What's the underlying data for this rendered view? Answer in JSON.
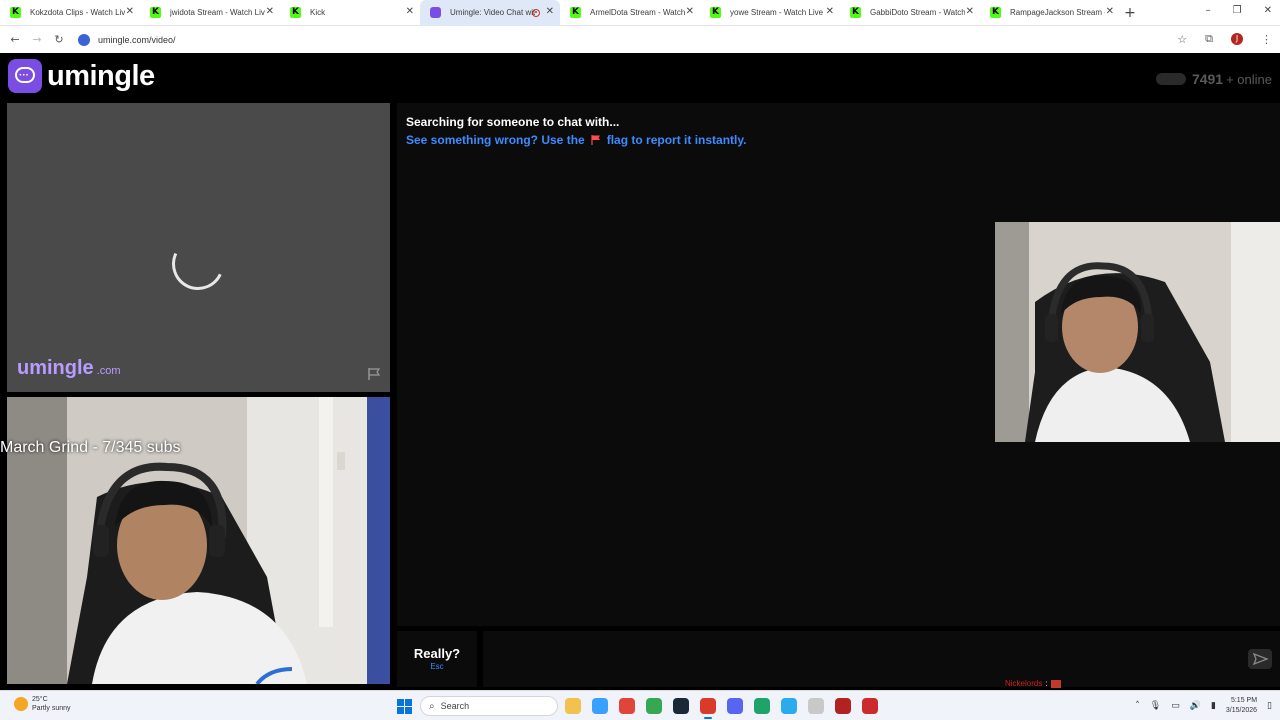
{
  "browser": {
    "tabs": [
      {
        "label": "Kokzdota Clips - Watch Live",
        "favicon": "kick"
      },
      {
        "label": "jwidota Stream - Watch Live",
        "favicon": "kick"
      },
      {
        "label": "Kick",
        "favicon": "kick"
      },
      {
        "label": "Umingle: Video Chat wit",
        "favicon": "umingle",
        "active": true,
        "recording": true
      },
      {
        "label": "ArmelDota Stream - Watch L",
        "favicon": "kick"
      },
      {
        "label": "yowe Stream - Watch Live o",
        "favicon": "kick"
      },
      {
        "label": "GabbiDoto Stream - Watch L",
        "favicon": "kick"
      },
      {
        "label": "RampageJackson Stream - W",
        "favicon": "kick"
      }
    ],
    "url": "umingle.com/video/"
  },
  "site": {
    "logo_text": "umingle",
    "online_count": "7491",
    "online_suffix": "+ online",
    "watermark": "umingle",
    "watermark_domain": ".com"
  },
  "stream_overlay": "March Grind - 7/345 subs",
  "chat": {
    "status": "Searching for someone to chat with...",
    "warning_pre": "See something wrong? Use the",
    "warning_post": "flag to report it instantly.",
    "really": "Really?",
    "esc": "Esc",
    "input_value": "",
    "input_placeholder": ""
  },
  "nickname_alert": {
    "name": "Nickelords",
    "sep": ":"
  },
  "taskbar": {
    "weather_temp": "25°C",
    "weather_desc": "Partly sunny",
    "search_placeholder": "Search",
    "time": "5:15 PM",
    "date": "3/15/2026"
  },
  "colors": {
    "brand_purple": "#7b4ee3",
    "link_blue": "#3d8bff"
  }
}
